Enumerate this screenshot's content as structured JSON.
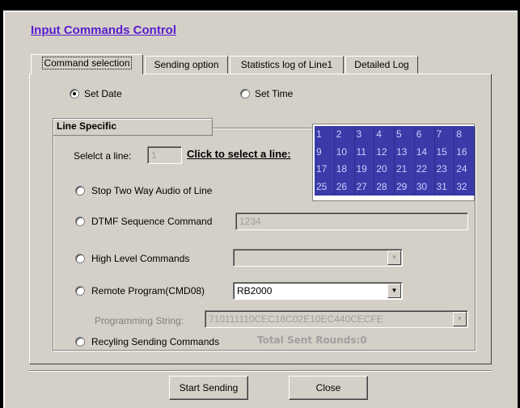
{
  "dialog": {
    "title": "Input Commands Control"
  },
  "tabs": [
    {
      "label": "Command selection",
      "active": true
    },
    {
      "label": "Sending option",
      "active": false
    },
    {
      "label": "Statistics log of Line1",
      "active": false
    },
    {
      "label": "Detailed Log",
      "active": false
    }
  ],
  "mode": {
    "set_date_label": "Set Date",
    "set_time_label": "Set Time",
    "selected": "Set Date"
  },
  "line_specific": {
    "group_title": "Line Specific",
    "select_line_label": "Selelct a line:",
    "selected_line": "1",
    "click_to_select_label": "Click to select a line:",
    "line_numbers": [
      "1",
      "2",
      "3",
      "4",
      "5",
      "6",
      "7",
      "8",
      "9",
      "10",
      "11",
      "12",
      "13",
      "14",
      "15",
      "16",
      "17",
      "18",
      "19",
      "20",
      "21",
      "22",
      "23",
      "24",
      "25",
      "26",
      "27",
      "28",
      "29",
      "30",
      "31",
      "32"
    ]
  },
  "commands": {
    "stop_audio_label": "Stop Two Way Audio of Line",
    "dtmf_label": "DTMF Sequence Command",
    "dtmf_value": "1234",
    "high_level_label": "High Level Commands",
    "high_level_value": "",
    "remote_program_label": "Remote Program(CMD08)",
    "remote_program_value": "RB2000",
    "programming_string_label": "Programming String:",
    "programming_string_value": "710111110CEC18C02E10EC440CECFE",
    "recycling_label": "Recyling Sending Commands",
    "total_sent_rounds": "Total Sent Rounds:0"
  },
  "buttons": {
    "start_sending": "Start Sending",
    "close": "Close"
  },
  "colors": {
    "dialog_bg": "#d4d0c8",
    "title_link": "#5a1ccf",
    "grid_bg": "#3a3aa8",
    "grid_text": "#c8d0ff"
  }
}
